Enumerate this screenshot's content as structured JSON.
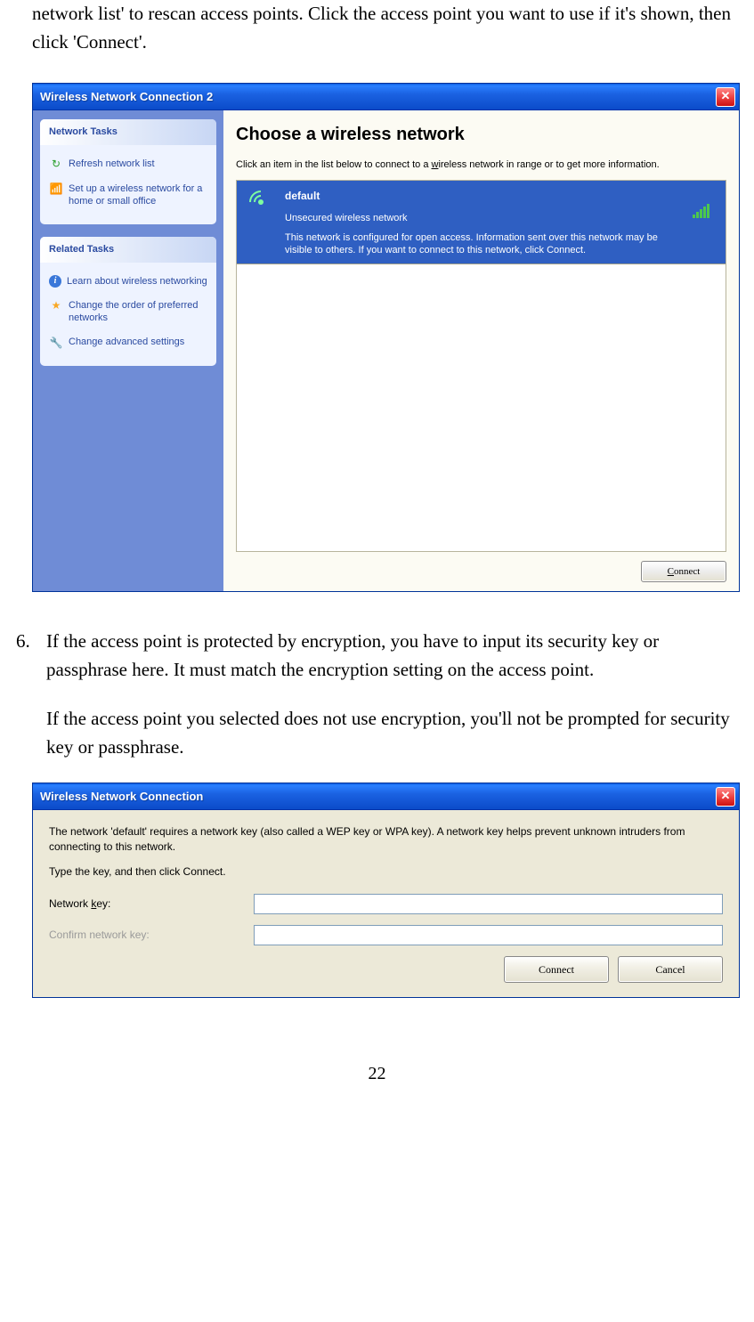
{
  "doc": {
    "intro": "network list' to rescan access points. Click the access point you want to use if it's shown, then click 'Connect'.",
    "step_number": "6.",
    "step_p1": "If the access point is protected by encryption, you have to input its security key or passphrase here. It must match the encryption setting on the access point.",
    "step_p2": "If the access point you selected does not use encryption, you'll not be prompted for security key or passphrase.",
    "page_number": "22"
  },
  "win1": {
    "title": "Wireless Network Connection 2",
    "sidebar": {
      "panel1_header": "Network Tasks",
      "panel1_items": [
        {
          "icon": "refresh",
          "label": "Refresh network list"
        },
        {
          "icon": "antenna",
          "label": "Set up a wireless network for a home or small office"
        }
      ],
      "panel2_header": "Related Tasks",
      "panel2_items": [
        {
          "icon": "info",
          "label": "Learn about wireless networking"
        },
        {
          "icon": "star",
          "label": "Change the order of preferred networks"
        },
        {
          "icon": "wrench",
          "label": "Change advanced settings"
        }
      ]
    },
    "main": {
      "heading": "Choose a wireless network",
      "instruction_pre": "Click an item in the list below to connect to a ",
      "instruction_uword": "w",
      "instruction_post": "ireless network in range or to get more information.",
      "network": {
        "name": "default",
        "subtitle": "Unsecured wireless network",
        "message": "This network is configured for open access. Information sent over this network may be visible to others. If you want to connect to this network, click Connect."
      },
      "connect_btn_u": "C",
      "connect_btn_rest": "onnect"
    }
  },
  "win2": {
    "title": "Wireless Network Connection",
    "prompt": "The network 'default' requires a network key (also called a WEP key or WPA key). A network key helps prevent unknown intruders from connecting to this network.",
    "type_line": "Type the key, and then click Connect.",
    "label_key_pre": "Network ",
    "label_key_u": "k",
    "label_key_post": "ey:",
    "label_confirm": "Confirm network key:",
    "key_value": "",
    "confirm_value": "",
    "connect_u": "C",
    "connect_rest": "onnect",
    "cancel": "Cancel"
  }
}
